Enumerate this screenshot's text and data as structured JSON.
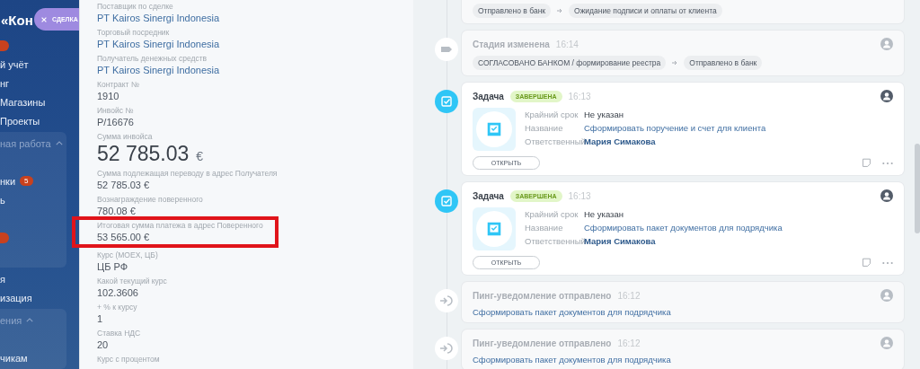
{
  "sidebar": {
    "logo": "«Кон",
    "deal_button": "СДЕЛКА",
    "items": [
      {
        "kind": "dot"
      },
      {
        "kind": "item",
        "label": "й учёт"
      },
      {
        "kind": "item",
        "label": "нг"
      },
      {
        "kind": "item",
        "label": "Магазины"
      },
      {
        "kind": "item",
        "label": "Проекты"
      },
      {
        "kind": "group",
        "label": "ная работа",
        "expanded": true,
        "children": [
          {
            "kind": "blank"
          },
          {
            "kind": "item",
            "label": "нки",
            "badge": "5"
          },
          {
            "kind": "item",
            "label": "ь"
          },
          {
            "kind": "blank"
          },
          {
            "kind": "dot"
          },
          {
            "kind": "blank"
          }
        ]
      },
      {
        "kind": "item",
        "label": "я"
      },
      {
        "kind": "item",
        "label": "изация"
      },
      {
        "kind": "group",
        "label": "ения",
        "expanded": true,
        "children": [
          {
            "kind": "blank"
          },
          {
            "kind": "item",
            "label": "чикам"
          }
        ]
      }
    ]
  },
  "details": [
    {
      "label": "Поставщик по сделке",
      "value": "PT Kairos Sinergi Indonesia",
      "kind": "link",
      "highlighted": false
    },
    {
      "label": "Торговый посредник",
      "value": "PT Kairos Sinergi Indonesia",
      "kind": "link",
      "highlighted": false
    },
    {
      "label": "Получатель денежных средств",
      "value": "PT Kairos Sinergi Indonesia",
      "kind": "link",
      "highlighted": false
    },
    {
      "label": "Контракт №",
      "value": "1910",
      "kind": "text",
      "highlighted": false
    },
    {
      "label": "Инвойс №",
      "value": "P/16676",
      "kind": "text",
      "highlighted": false
    },
    {
      "label": "Сумма инвойса",
      "value": "52 785.03",
      "currency": "€",
      "kind": "big",
      "highlighted": false
    },
    {
      "label": "Сумма подлежащая переводу в адрес Получателя",
      "value": "52 785.03 €",
      "kind": "text",
      "highlighted": false
    },
    {
      "label": "Вознаграждение поверенного",
      "value": "780.08 €",
      "kind": "text",
      "highlighted": false
    },
    {
      "label": "Итоговая сумма платежа в адрес Поверенного",
      "value": "53 565.00 €",
      "kind": "text",
      "highlighted": true
    },
    {
      "label": "Курс (MOEX, ЦБ)",
      "value": "ЦБ РФ",
      "kind": "text",
      "highlighted": false
    },
    {
      "label": "Какой текущий курс",
      "value": "102.3606",
      "kind": "text",
      "highlighted": false
    },
    {
      "label": "+ % к курсу",
      "value": "1",
      "kind": "text",
      "highlighted": false
    },
    {
      "label": "Ставка НДС",
      "value": "20",
      "kind": "text",
      "highlighted": false
    },
    {
      "label": "Курс с процентом",
      "kind": "text",
      "highlighted": false
    }
  ],
  "timeline": [
    {
      "kind": "stage-tail",
      "from": "Отправлено в банк",
      "to": "Ожидание подписи и оплаты от клиента"
    },
    {
      "kind": "stage",
      "title": "Стадия изменена",
      "time": "16:14",
      "from": "СОГЛАСОВАНО БАНКОМ / формирование реестра",
      "to": "Отправлено в банк"
    },
    {
      "kind": "task",
      "title": "Задача",
      "status": "ЗАВЕРШЕНА",
      "time": "16:13",
      "fields": [
        {
          "label": "Крайний срок",
          "value": "Не указан",
          "kind": "text"
        },
        {
          "label": "Название",
          "value": "Сформировать поручение и счет для клиента",
          "kind": "link"
        },
        {
          "label": "Ответственный",
          "value": "Мария Симакова",
          "kind": "person"
        }
      ],
      "button": "ОТКРЫТЬ"
    },
    {
      "kind": "task",
      "title": "Задача",
      "status": "ЗАВЕРШЕНА",
      "time": "16:13",
      "fields": [
        {
          "label": "Крайний срок",
          "value": "Не указан",
          "kind": "text"
        },
        {
          "label": "Название",
          "value": "Сформировать пакет документов для подрядчика",
          "kind": "link"
        },
        {
          "label": "Ответственный",
          "value": "Мария Симакова",
          "kind": "person"
        }
      ],
      "button": "ОТКРЫТЬ"
    },
    {
      "kind": "ping",
      "title": "Пинг-уведомление отправлено",
      "time": "16:12",
      "text": "Сформировать пакет документов для подрядчика"
    },
    {
      "kind": "ping",
      "title": "Пинг-уведомление отправлено",
      "time": "16:12",
      "text": "Сформировать пакет документов для подрядчика"
    }
  ]
}
